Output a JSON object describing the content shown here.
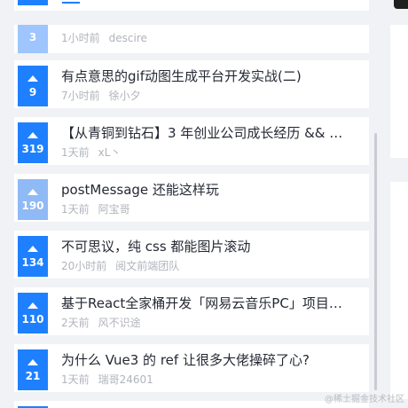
{
  "feed": {
    "items": [
      {
        "votes": "3",
        "title": "",
        "time": "1小时前",
        "author": "descire",
        "style": "faded"
      },
      {
        "votes": "9",
        "title": "有点意思的gif动图生成平台开发实战(二)",
        "time": "7小时前",
        "author": "徐小夕",
        "style": "normal"
      },
      {
        "votes": "319",
        "title": "【从青铜到钻石】3 年创业公司成长经历 && …",
        "time": "1天前",
        "author": "xL丶",
        "style": "normal"
      },
      {
        "votes": "190",
        "title": "postMessage 还能这样玩",
        "time": "1天前",
        "author": "阿宝哥",
        "style": "dim"
      },
      {
        "votes": "134",
        "title": "不可思议，纯 css 都能图片滚动",
        "time": "20小时前",
        "author": "阅文前端团队",
        "style": "normal"
      },
      {
        "votes": "110",
        "title": "基于React全家桶开发「网易云音乐PC」项目…",
        "time": "2天前",
        "author": "风不识途",
        "style": "normal"
      },
      {
        "votes": "21",
        "title": "为什么 Vue3 的 ref 让很多大佬操碎了心?",
        "time": "1天前",
        "author": "瑞哥24601",
        "style": "normal"
      }
    ]
  },
  "watermark": "@稀土掘金技术社区",
  "colors": {
    "accent": "#1e80ff",
    "background": "#f0f2f5"
  }
}
